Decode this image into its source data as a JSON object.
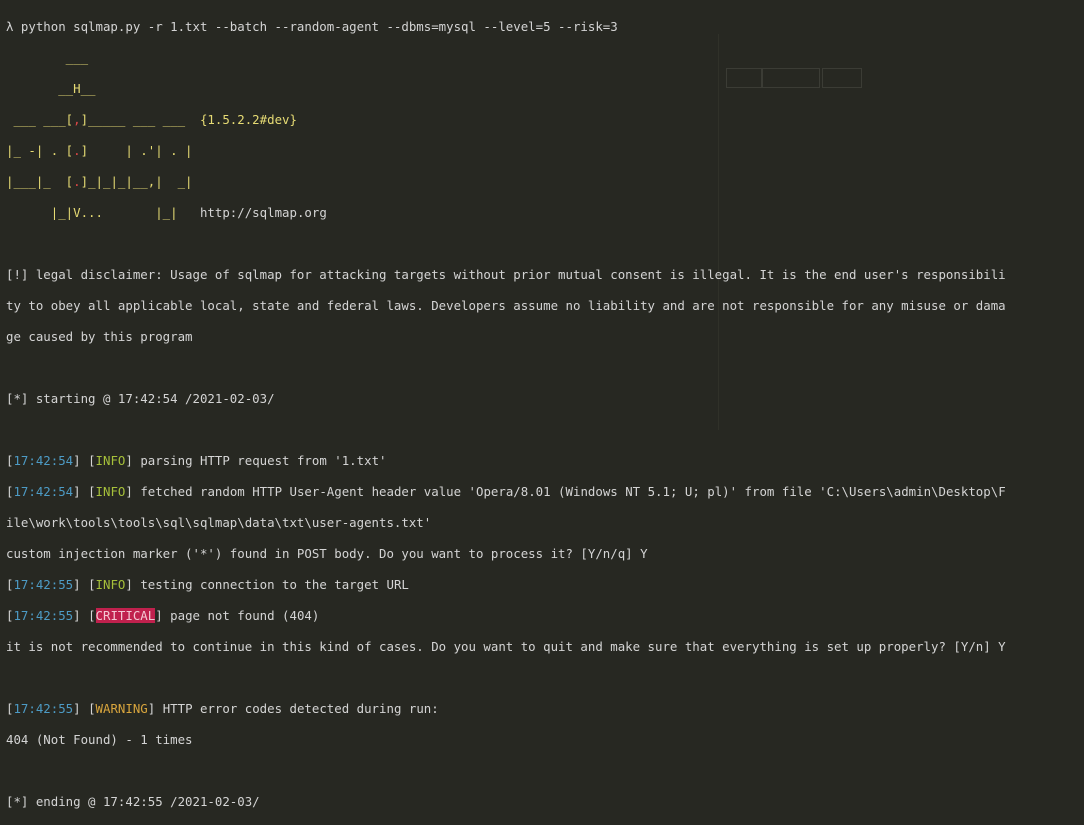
{
  "prompt_line": "λ python sqlmap.py -r 1.txt --batch --random-agent --dbms=mysql --level=5 --risk=3",
  "logo": {
    "l1": "        ___",
    "l2a": "       __H__",
    "l3a": " ___ ___[",
    "l3b": ",",
    "l3c": "]_____ ___ ___  ",
    "l3d": "{1.5.2.2#dev}",
    "l4a": "|_ -| . [",
    "l4b": ".",
    "l4c": "]     | .'| . |",
    "l5a": "|___|_  [",
    "l5b": ".",
    "l5c": "]_|_|_|__,|  _|",
    "l6a": "      |_|V...       |_|   ",
    "l6b": "http://sqlmap.org"
  },
  "disclaimer": [
    "[!] legal disclaimer: Usage of sqlmap for attacking targets without prior mutual consent is illegal. It is the end user's responsibili",
    "ty to obey all applicable local, state and federal laws. Developers assume no liability and are not responsible for any misuse or dama",
    "ge caused by this program"
  ],
  "starting": "[*] starting @ 17:42:54 /2021-02-03/",
  "log": [
    {
      "time": "17:42:54",
      "level": "INFO",
      "msg": "parsing HTTP request from '1.txt'"
    },
    {
      "time": "17:42:54",
      "level": "INFO",
      "msg": "fetched random HTTP User-Agent header value 'Opera/8.01 (Windows NT 5.1; U; pl)' from file 'C:\\Users\\admin\\Desktop\\F"
    },
    {
      "cont": "ile\\work\\tools\\tools\\sql\\sqlmap\\data\\txt\\user-agents.txt'"
    },
    {
      "plain": "custom injection marker ('*') found in POST body. Do you want to process it? [Y/n/q] Y"
    },
    {
      "time": "17:42:55",
      "level": "INFO",
      "msg": "testing connection to the target URL"
    },
    {
      "time": "17:42:55",
      "level": "CRITICAL",
      "msg": "page not found (404)"
    },
    {
      "plain": "it is not recommended to continue in this kind of cases. Do you want to quit and make sure that everything is set up properly? [Y/n] Y"
    }
  ],
  "warning": {
    "time": "17:42:55",
    "level": "WARNING",
    "msg": "HTTP error codes detected during run:"
  },
  "error_count": "404 (Not Found) - 1 times",
  "ending": "[*] ending @ 17:42:55 /2021-02-03/"
}
